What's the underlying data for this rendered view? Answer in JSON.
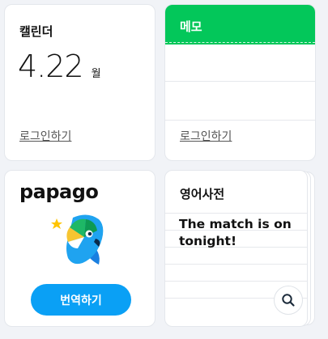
{
  "calendar": {
    "title": "캘린더",
    "date": "4.22",
    "day_unit": "월",
    "login_link": "로그인하기"
  },
  "memo": {
    "title": "메모",
    "header_color": "#03c75a",
    "login_link": "로그인하기"
  },
  "papago": {
    "logo_text": "papago",
    "logo_icon": "parrot-icon",
    "translate_button": "번역하기",
    "accent_color": "#0aa0f5"
  },
  "dictionary": {
    "title": "영어사전",
    "word": "The match is on tonight!",
    "search_icon": "search-icon"
  }
}
